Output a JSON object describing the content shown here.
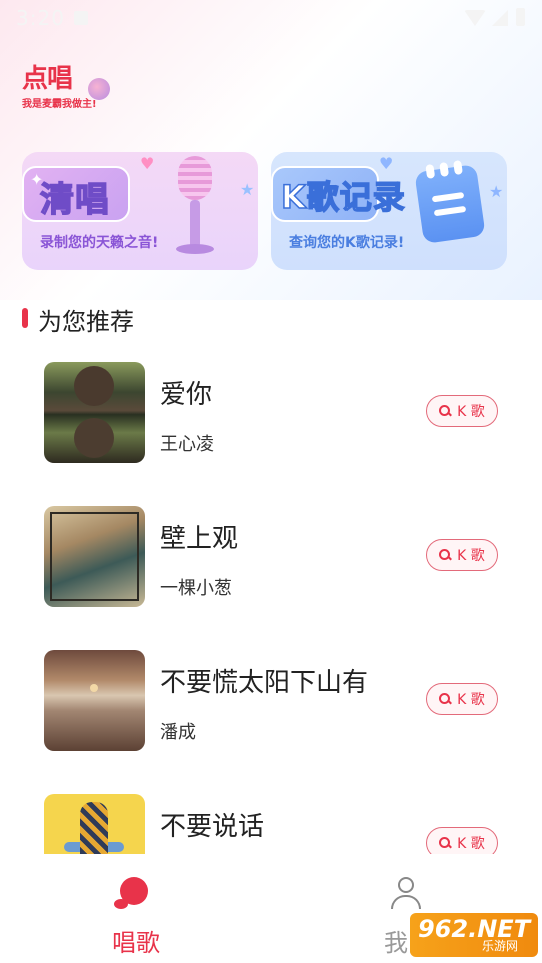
{
  "status_bar": {
    "time": "3:20"
  },
  "header": {
    "logo_title": "点唱",
    "logo_slogan": "我是麦霸我做主!"
  },
  "cards": [
    {
      "title": "清唱",
      "subtitle": "录制您的天籁之音!"
    },
    {
      "title": "K歌记录",
      "subtitle": "查询您的K歌记录!"
    }
  ],
  "section": {
    "title": "为您推荐"
  },
  "songs": [
    {
      "name": "爱你",
      "singer": "王心凌",
      "button": "K 歌"
    },
    {
      "name": "壁上观",
      "singer": "一棵小葱",
      "button": "K 歌"
    },
    {
      "name": "不要慌太阳下山有",
      "singer": "潘成",
      "button": "K 歌"
    },
    {
      "name": "不要说话",
      "singer": "",
      "button": "K 歌"
    }
  ],
  "bottom_nav": [
    {
      "label": "唱歌",
      "active": true
    },
    {
      "label": "我的",
      "active": false
    }
  ],
  "watermark": {
    "text": "962.NET",
    "sub": "乐游网"
  },
  "colors": {
    "accent": "#e8334a",
    "inactive": "#999999"
  }
}
